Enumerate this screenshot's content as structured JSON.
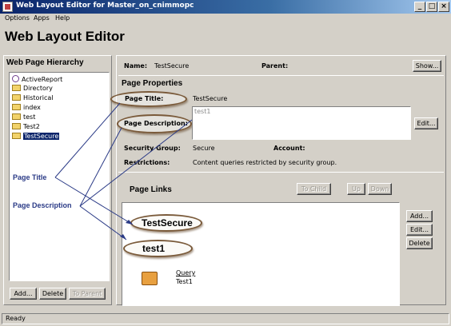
{
  "window": {
    "title": "Web Layout Editor for Master_on_cnimmopc",
    "minimize": "_",
    "maximize": "□",
    "close": "×"
  },
  "menu": [
    "Options",
    "Apps",
    "Help"
  ],
  "page_heading": "Web Layout Editor",
  "hierarchy": {
    "title": "Web Page Hierarchy",
    "items": [
      {
        "label": "ActiveReport",
        "icon": "report-icon"
      },
      {
        "label": "Directory",
        "icon": "folder-icon"
      },
      {
        "label": "Historical",
        "icon": "folder-icon"
      },
      {
        "label": "index",
        "icon": "folder-icon"
      },
      {
        "label": "test",
        "icon": "folder-icon"
      },
      {
        "label": "Test2",
        "icon": "folder-icon"
      },
      {
        "label": "TestSecure",
        "icon": "folder-icon",
        "selected": true
      }
    ],
    "buttons": {
      "add": "Add...",
      "delete": "Delete",
      "to_parent": "To Parent"
    }
  },
  "header": {
    "name_label": "Name:",
    "name_value": "TestSecure",
    "parent_label": "Parent:",
    "show_button": "Show..."
  },
  "properties": {
    "title": "Page Properties",
    "page_title_label": "Page Title:",
    "page_title_value": "TestSecure",
    "page_description_label": "Page Description:",
    "page_description_value": "test1",
    "edit_button": "Edit...",
    "security_group_label": "Security Group:",
    "security_group_value": "Secure",
    "account_label": "Account:",
    "restrictions_label": "Restrictions:",
    "restrictions_value": "Content queries restricted by security group."
  },
  "links": {
    "title": "Page Links",
    "to_child": "To Child",
    "up": "Up",
    "down": "Down",
    "add": "Add...",
    "edit": "Edit...",
    "delete": "Delete",
    "item_title": "TestSecure",
    "item_description": "test1",
    "query_label": "Query",
    "query_name": "Test1"
  },
  "annotations": {
    "page_title": "Page Title",
    "page_description": "Page Description"
  },
  "status": "Ready",
  "colors": {
    "titlebar": "#0a246a",
    "selection": "#0a246a",
    "annotation": "#2a3a86",
    "oval_border": "#7a5a3a"
  }
}
